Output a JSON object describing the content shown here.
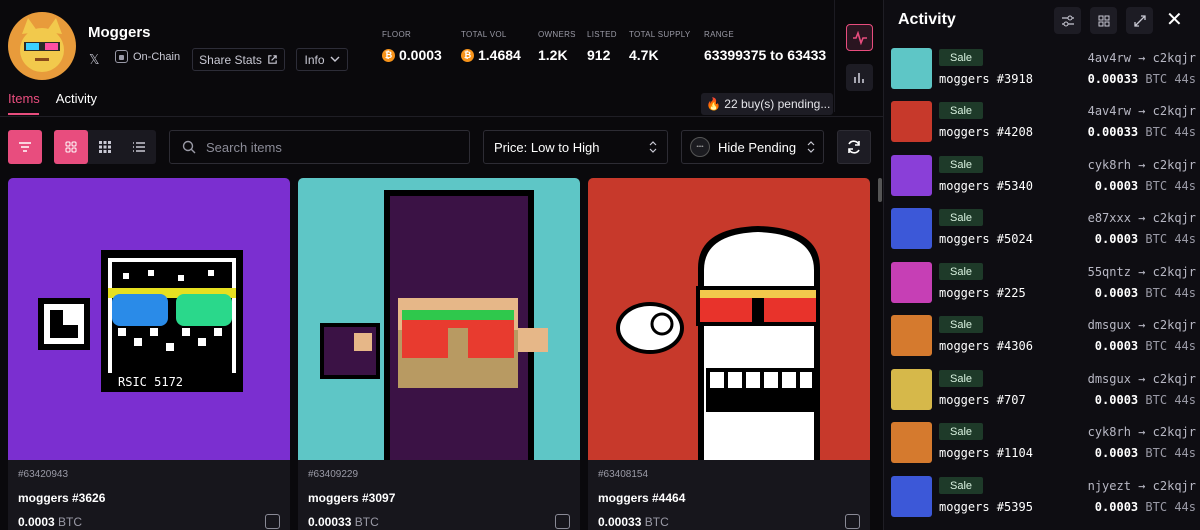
{
  "collection": {
    "name": "Moggers",
    "on_chain_label": "On-Chain",
    "share_label": "Share Stats",
    "info_label": "Info",
    "x_icon": "x-icon"
  },
  "stats": [
    {
      "label": "FLOOR",
      "value": "0.0003",
      "btc": true
    },
    {
      "label": "TOTAL VOL",
      "value": "1.4684",
      "btc": true
    },
    {
      "label": "OWNERS",
      "value": "1.2K",
      "btc": false
    },
    {
      "label": "LISTED",
      "value": "912",
      "btc": false
    },
    {
      "label": "TOTAL SUPPLY",
      "value": "4.7K",
      "btc": false
    },
    {
      "label": "RANGE",
      "value": "63399375 to 63433",
      "btc": false
    }
  ],
  "tabs": {
    "items": "Items",
    "activity": "Activity"
  },
  "pending_text": "🔥 22 buy(s) pending...",
  "toolbar": {
    "search_placeholder": "Search items",
    "sort_label": "Price: Low to High",
    "hide_pending_label": "Hide Pending",
    "toggle_text": "••••"
  },
  "cards": [
    {
      "id": "#63420943",
      "name": "moggers #3626",
      "price": "0.0003",
      "unit": "BTC",
      "bg": "#7b2fd0"
    },
    {
      "id": "#63409229",
      "name": "moggers #3097",
      "price": "0.00033",
      "unit": "BTC",
      "bg": "#5ec6c6"
    },
    {
      "id": "#63408154",
      "name": "moggers #4464",
      "price": "0.00033",
      "unit": "BTC",
      "bg": "#c7392b"
    }
  ],
  "activity": {
    "title": "Activity",
    "rows": [
      {
        "type": "Sale",
        "name": "moggers #3918",
        "from": "4av4rw",
        "to": "c2kqjr",
        "price": "0.00033",
        "unit": "BTC",
        "ago": "44s",
        "bg": "#5ec6c6"
      },
      {
        "type": "Sale",
        "name": "moggers #4208",
        "from": "4av4rw",
        "to": "c2kqjr",
        "price": "0.00033",
        "unit": "BTC",
        "ago": "44s",
        "bg": "#c7392b"
      },
      {
        "type": "Sale",
        "name": "moggers #5340",
        "from": "cyk8rh",
        "to": "c2kqjr",
        "price": "0.0003",
        "unit": "BTC",
        "ago": "44s",
        "bg": "#8a3fd8"
      },
      {
        "type": "Sale",
        "name": "moggers #5024",
        "from": "e87xxx",
        "to": "c2kqjr",
        "price": "0.0003",
        "unit": "BTC",
        "ago": "44s",
        "bg": "#3c58d8"
      },
      {
        "type": "Sale",
        "name": "moggers #225",
        "from": "55qntz",
        "to": "c2kqjr",
        "price": "0.0003",
        "unit": "BTC",
        "ago": "44s",
        "bg": "#c63fb5"
      },
      {
        "type": "Sale",
        "name": "moggers #4306",
        "from": "dmsgux",
        "to": "c2kqjr",
        "price": "0.0003",
        "unit": "BTC",
        "ago": "44s",
        "bg": "#d57a2e"
      },
      {
        "type": "Sale",
        "name": "moggers #707",
        "from": "dmsgux",
        "to": "c2kqjr",
        "price": "0.0003",
        "unit": "BTC",
        "ago": "44s",
        "bg": "#d6b84a"
      },
      {
        "type": "Sale",
        "name": "moggers #1104",
        "from": "cyk8rh",
        "to": "c2kqjr",
        "price": "0.0003",
        "unit": "BTC",
        "ago": "44s",
        "bg": "#d57a2e"
      },
      {
        "type": "Sale",
        "name": "moggers #5395",
        "from": "njyezt",
        "to": "c2kqjr",
        "price": "0.0003",
        "unit": "BTC",
        "ago": "44s",
        "bg": "#3c58d8"
      }
    ]
  }
}
